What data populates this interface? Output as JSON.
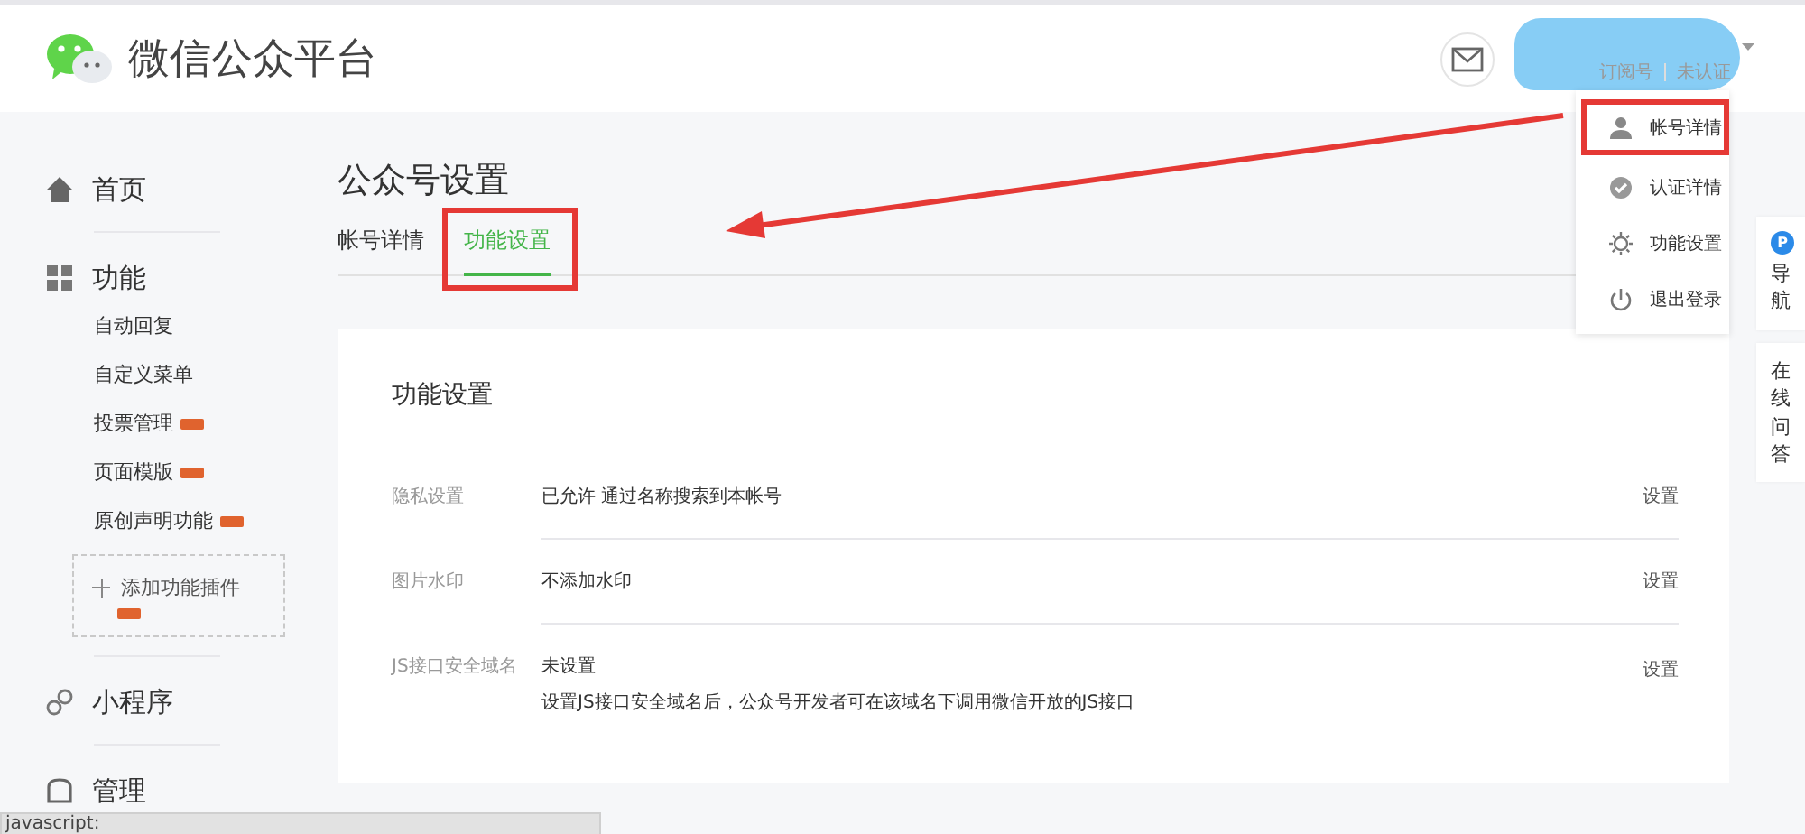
{
  "header": {
    "title": "微信公众平台",
    "account_type": "订阅号",
    "verification": "未认证"
  },
  "account_menu": [
    {
      "label": "帐号详情",
      "kind": "user",
      "highlighted": true
    },
    {
      "label": "认证详情",
      "kind": "check",
      "highlighted": false
    },
    {
      "label": "功能设置",
      "kind": "gear",
      "highlighted": false
    },
    {
      "label": "退出登录",
      "kind": "power",
      "highlighted": false
    }
  ],
  "sidebar": [
    {
      "label": "首页",
      "kind": "home"
    },
    {
      "label": "功能",
      "kind": "grid",
      "children": [
        {
          "label": "自动回复",
          "new": false
        },
        {
          "label": "自定义菜单",
          "new": false
        },
        {
          "label": "投票管理",
          "new": true
        },
        {
          "label": "页面模版",
          "new": true
        },
        {
          "label": "原创声明功能",
          "new": true
        }
      ],
      "add_plugin": {
        "label": "添加功能插件",
        "new": true
      }
    },
    {
      "label": "小程序",
      "kind": "link"
    },
    {
      "label": "管理",
      "kind": "box"
    }
  ],
  "page": {
    "title": "公众号设置",
    "tabs": [
      {
        "label": "帐号详情",
        "selected": false,
        "highlighted": false
      },
      {
        "label": "功能设置",
        "selected": true,
        "highlighted": true
      }
    ]
  },
  "card": {
    "title": "功能设置",
    "rows": [
      {
        "label": "隐私设置",
        "lines": [
          "已允许 通过名称搜索到本帐号"
        ],
        "action": "设置"
      },
      {
        "label": "图片水印",
        "lines": [
          "不添加水印"
        ],
        "action": "设置"
      },
      {
        "label": "JS接口安全域名",
        "lines": [
          "未设置",
          "设置JS接口安全域名后，公众号开发者可在该域名下调用微信开放的JS接口"
        ],
        "action": "设置"
      }
    ]
  },
  "float_tabs": [
    {
      "label": "导航",
      "badge": "P"
    },
    {
      "label": "在线问答"
    }
  ],
  "status_bar": "javascript:"
}
